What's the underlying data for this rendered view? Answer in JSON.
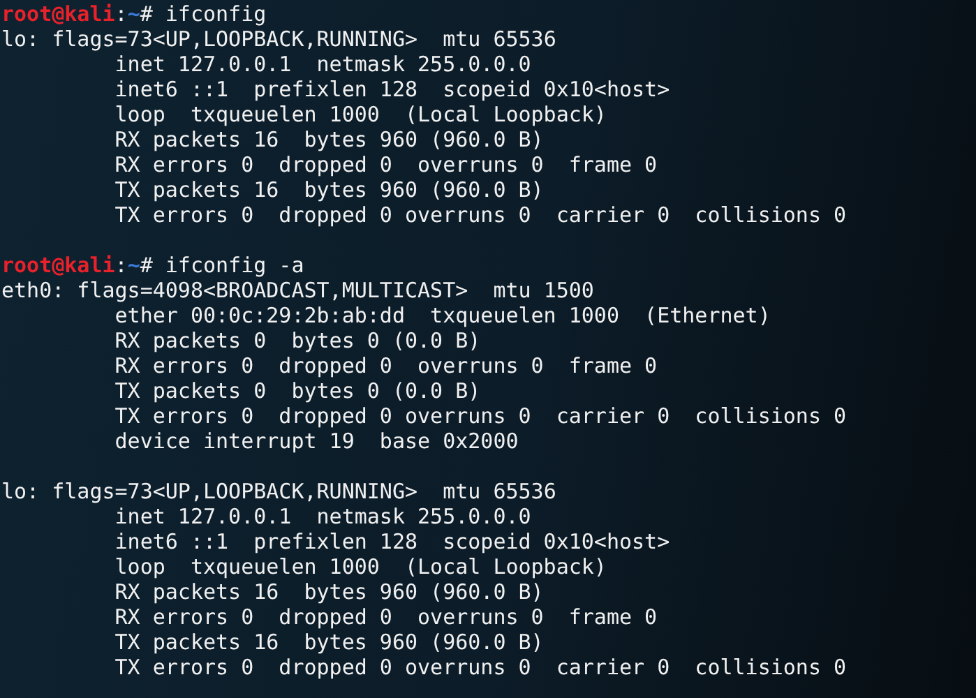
{
  "terminal": {
    "lines": [
      {
        "kind": "prompt",
        "user": "root@kali",
        "separator": ":",
        "path": "~",
        "symbol": "#",
        "command": "ifconfig"
      },
      {
        "kind": "output",
        "indented": false,
        "text": "lo: flags=73<UP,LOOPBACK,RUNNING>  mtu 65536"
      },
      {
        "kind": "output",
        "indented": true,
        "text": "inet 127.0.0.1  netmask 255.0.0.0"
      },
      {
        "kind": "output",
        "indented": true,
        "text": "inet6 ::1  prefixlen 128  scopeid 0x10<host>"
      },
      {
        "kind": "output",
        "indented": true,
        "text": "loop  txqueuelen 1000  (Local Loopback)"
      },
      {
        "kind": "output",
        "indented": true,
        "text": "RX packets 16  bytes 960 (960.0 B)"
      },
      {
        "kind": "output",
        "indented": true,
        "text": "RX errors 0  dropped 0  overruns 0  frame 0"
      },
      {
        "kind": "output",
        "indented": true,
        "text": "TX packets 16  bytes 960 (960.0 B)"
      },
      {
        "kind": "output",
        "indented": true,
        "text": "TX errors 0  dropped 0 overruns 0  carrier 0  collisions 0"
      },
      {
        "kind": "blank"
      },
      {
        "kind": "prompt",
        "user": "root@kali",
        "separator": ":",
        "path": "~",
        "symbol": "#",
        "command": "ifconfig -a"
      },
      {
        "kind": "output",
        "indented": false,
        "text": "eth0: flags=4098<BROADCAST,MULTICAST>  mtu 1500"
      },
      {
        "kind": "output",
        "indented": true,
        "text": "ether 00:0c:29:2b:ab:dd  txqueuelen 1000  (Ethernet)"
      },
      {
        "kind": "output",
        "indented": true,
        "text": "RX packets 0  bytes 0 (0.0 B)"
      },
      {
        "kind": "output",
        "indented": true,
        "text": "RX errors 0  dropped 0  overruns 0  frame 0"
      },
      {
        "kind": "output",
        "indented": true,
        "text": "TX packets 0  bytes 0 (0.0 B)"
      },
      {
        "kind": "output",
        "indented": true,
        "text": "TX errors 0  dropped 0 overruns 0  carrier 0  collisions 0"
      },
      {
        "kind": "output",
        "indented": true,
        "text": "device interrupt 19  base 0x2000"
      },
      {
        "kind": "blank"
      },
      {
        "kind": "output",
        "indented": false,
        "text": "lo: flags=73<UP,LOOPBACK,RUNNING>  mtu 65536"
      },
      {
        "kind": "output",
        "indented": true,
        "text": "inet 127.0.0.1  netmask 255.0.0.0"
      },
      {
        "kind": "output",
        "indented": true,
        "text": "inet6 ::1  prefixlen 128  scopeid 0x10<host>"
      },
      {
        "kind": "output",
        "indented": true,
        "text": "loop  txqueuelen 1000  (Local Loopback)"
      },
      {
        "kind": "output",
        "indented": true,
        "text": "RX packets 16  bytes 960 (960.0 B)"
      },
      {
        "kind": "output",
        "indented": true,
        "text": "RX errors 0  dropped 0  overruns 0  frame 0"
      },
      {
        "kind": "output",
        "indented": true,
        "text": "TX packets 16  bytes 960 (960.0 B)"
      },
      {
        "kind": "output",
        "indented": true,
        "text": "TX errors 0  dropped 0 overruns 0  carrier 0  collisions 0"
      }
    ]
  }
}
